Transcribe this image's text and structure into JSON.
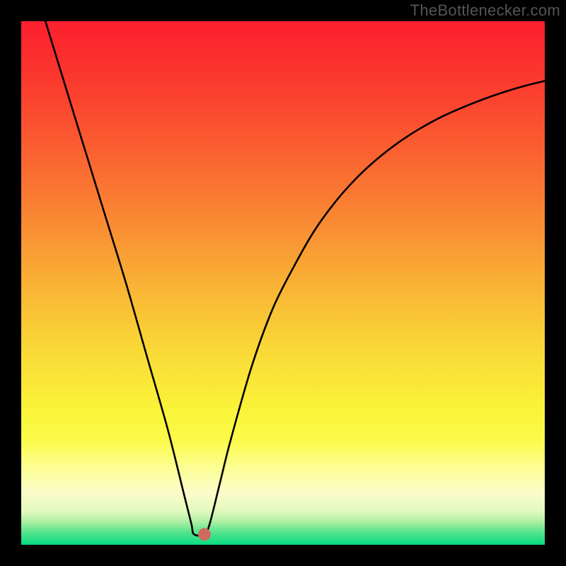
{
  "watermark": "TheBottlenecker.com",
  "chart_data": {
    "type": "line",
    "title": "",
    "xlabel": "",
    "ylabel": "",
    "xlim": [
      0,
      100
    ],
    "ylim": [
      0,
      100
    ],
    "grid": false,
    "legend": false,
    "curve": {
      "name": "bottleneck-curve",
      "color": "#000000",
      "min_x": 34.0,
      "min_y": 2.0,
      "points": [
        {
          "x": 4.0,
          "y": 102.0
        },
        {
          "x": 8.0,
          "y": 89.0
        },
        {
          "x": 12.0,
          "y": 76.0
        },
        {
          "x": 16.0,
          "y": 63.0
        },
        {
          "x": 20.0,
          "y": 50.0
        },
        {
          "x": 24.0,
          "y": 36.0
        },
        {
          "x": 28.0,
          "y": 22.0
        },
        {
          "x": 31.0,
          "y": 10.0
        },
        {
          "x": 32.5,
          "y": 4.0
        },
        {
          "x": 33.0,
          "y": 2.0
        },
        {
          "x": 35.0,
          "y": 2.0
        },
        {
          "x": 36.0,
          "y": 4.0
        },
        {
          "x": 38.0,
          "y": 12.0
        },
        {
          "x": 40.0,
          "y": 20.0
        },
        {
          "x": 44.0,
          "y": 34.0
        },
        {
          "x": 48.0,
          "y": 45.0
        },
        {
          "x": 52.0,
          "y": 53.0
        },
        {
          "x": 56.0,
          "y": 60.0
        },
        {
          "x": 60.0,
          "y": 65.5
        },
        {
          "x": 64.0,
          "y": 70.0
        },
        {
          "x": 68.0,
          "y": 73.7
        },
        {
          "x": 72.0,
          "y": 76.8
        },
        {
          "x": 76.0,
          "y": 79.4
        },
        {
          "x": 80.0,
          "y": 81.6
        },
        {
          "x": 84.0,
          "y": 83.4
        },
        {
          "x": 88.0,
          "y": 85.0
        },
        {
          "x": 92.0,
          "y": 86.4
        },
        {
          "x": 96.0,
          "y": 87.6
        },
        {
          "x": 100.0,
          "y": 88.6
        }
      ]
    },
    "marker": {
      "x": 35.0,
      "y": 2.0,
      "r_pct": 1.2,
      "fill": "#cf6a5e"
    },
    "background": {
      "type": "vertical-gradient",
      "stops": [
        {
          "pos": 0.0,
          "color": "#fb1f2e"
        },
        {
          "pos": 0.12,
          "color": "#fb3b2e"
        },
        {
          "pos": 0.25,
          "color": "#fa6131"
        },
        {
          "pos": 0.38,
          "color": "#f98933"
        },
        {
          "pos": 0.5,
          "color": "#f9b135"
        },
        {
          "pos": 0.62,
          "color": "#f9d737"
        },
        {
          "pos": 0.74,
          "color": "#faf339"
        },
        {
          "pos": 0.8,
          "color": "#fbfb4a"
        },
        {
          "pos": 0.85,
          "color": "#fdfe91"
        },
        {
          "pos": 0.9,
          "color": "#fbfdca"
        },
        {
          "pos": 0.935,
          "color": "#e3f9c0"
        },
        {
          "pos": 0.955,
          "color": "#b0f0a3"
        },
        {
          "pos": 0.975,
          "color": "#5be48e"
        },
        {
          "pos": 1.0,
          "color": "#07db81"
        }
      ]
    },
    "axes_visible": false
  }
}
